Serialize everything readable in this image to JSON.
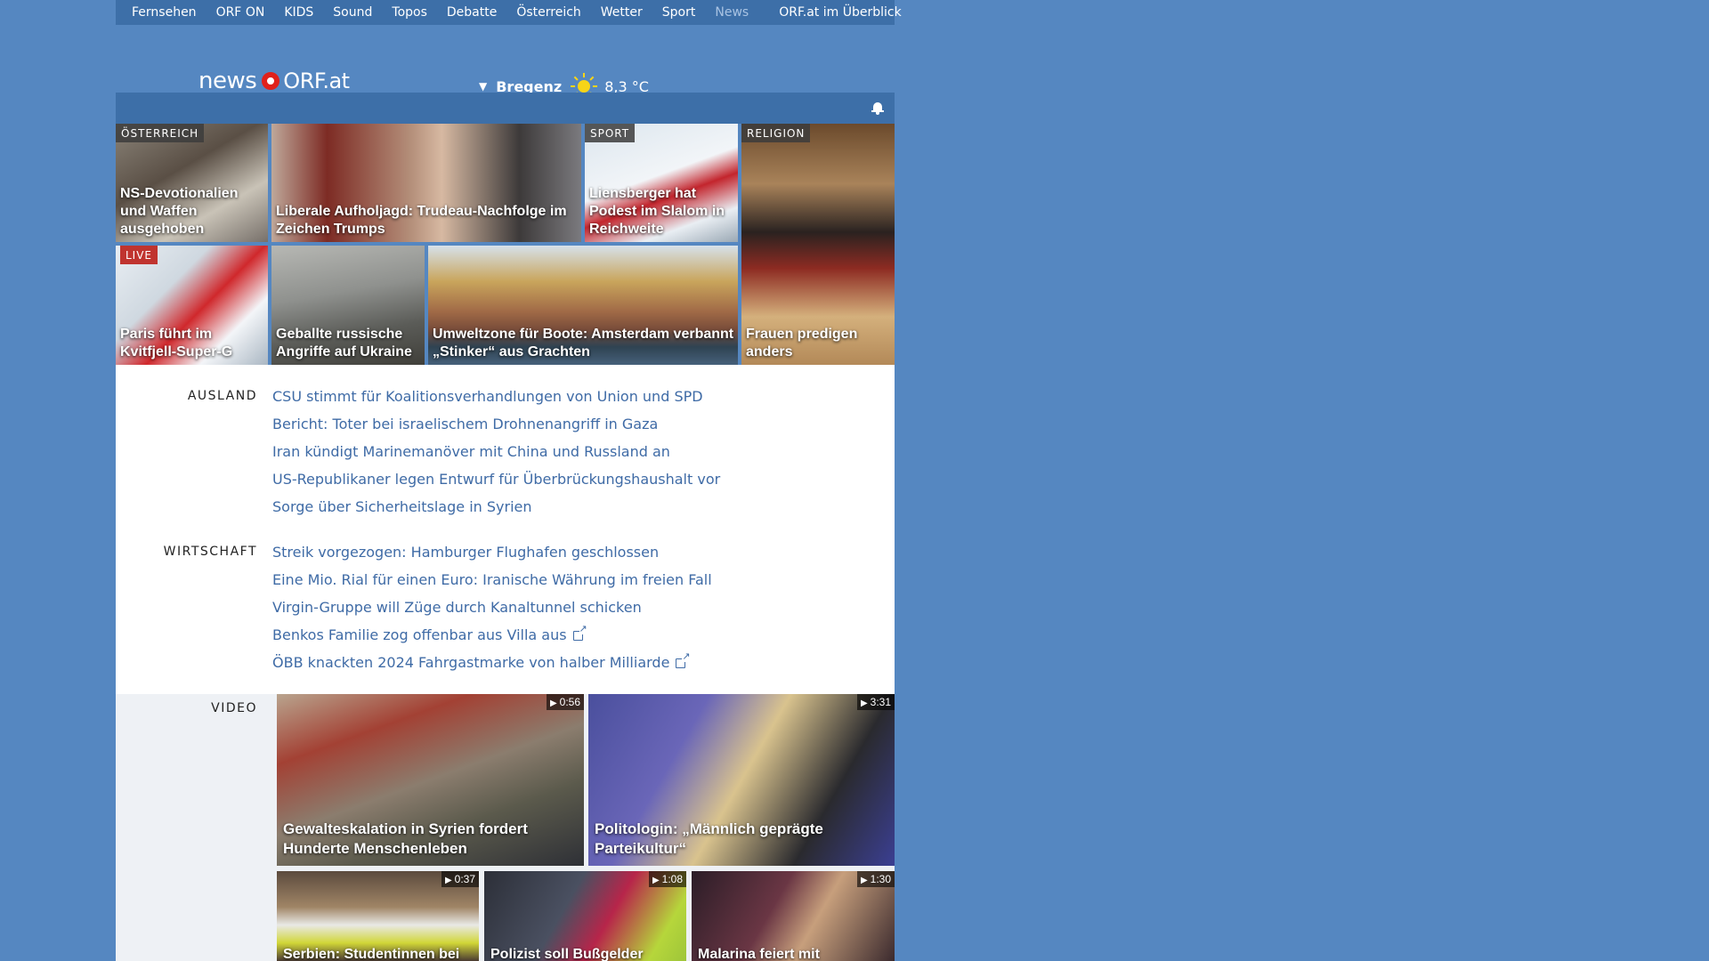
{
  "nav": {
    "items": [
      "Fernsehen",
      "ORF ON",
      "KIDS",
      "Sound",
      "Topos",
      "Debatte",
      "Österreich",
      "Wetter",
      "Sport",
      "News"
    ],
    "overview": "ORF.at im Überblick"
  },
  "logo": {
    "news": "news",
    "orf": "ORF.at"
  },
  "weather": {
    "location": "Bregenz",
    "temperature": "8,3 °C",
    "icon": "sun-icon"
  },
  "teasers": [
    {
      "badge": "ÖSTERREICH",
      "caption": "NS-Devotionalien und Waffen ausgehoben"
    },
    {
      "badge": "",
      "caption": "Liberale Aufholjagd: Trudeau-Nachfolge im Zeichen Trumps"
    },
    {
      "badge": "SPORT",
      "caption": "Liensberger hat Podest im Slalom in Reichweite"
    },
    {
      "badge": "RELIGION",
      "caption": "Frauen predigen anders"
    },
    {
      "badge": "LIVE",
      "caption": "Paris führt im Kvitfjell-Super-G"
    },
    {
      "badge": "",
      "caption": "Geballte russische Angriffe auf Ukraine"
    },
    {
      "badge": "",
      "caption": "Umweltzone für Boote: Amsterdam verbannt „Stinker“ aus Grachten"
    }
  ],
  "sections": {
    "ausland": {
      "label": "AUSLAND",
      "headlines": [
        "CSU stimmt für Koalitionsverhandlungen von Union und SPD",
        "Bericht: Toter bei israelischem Drohnenangriff in Gaza",
        "Iran kündigt Marinemanöver mit China und Russland an",
        "US-Republikaner legen Entwurf für Überbrückungshaushalt vor",
        "Sorge über Sicherheitslage in Syrien"
      ]
    },
    "wirtschaft": {
      "label": "WIRTSCHAFT",
      "headlines": [
        "Streik vorgezogen: Hamburger Flughafen geschlossen",
        "Eine Mio. Rial für einen Euro: Iranische Währung im freien Fall",
        "Virgin-Gruppe will Züge durch Kanaltunnel schicken",
        "Benkos Familie zog offenbar aus Villa aus",
        "ÖBB knackten 2024 Fahrgastmarke von halber Milliarde"
      ]
    }
  },
  "video": {
    "label": "VIDEO",
    "items": [
      {
        "duration": "0:56",
        "caption": "Gewalteskalation in Syrien fordert Hunderte Menschenleben"
      },
      {
        "duration": "3:31",
        "caption": "Politologin: „Männlich geprägte Parteikultur“"
      },
      {
        "duration": "0:37",
        "caption": "Serbien: Studentinnen bei"
      },
      {
        "duration": "1:08",
        "caption": "Polizist soll Bußgelder"
      },
      {
        "duration": "1:30",
        "caption": "Malarina feiert mit"
      }
    ]
  },
  "colors": {
    "page_bg": "#5587c1",
    "nav_bg": "#3d6fa8",
    "link": "#3f6ba6",
    "logo_red": "#e0211b",
    "live_badge": "#c0342f"
  }
}
